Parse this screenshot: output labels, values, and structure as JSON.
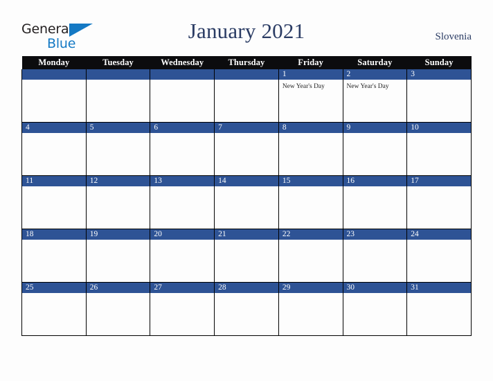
{
  "brand": {
    "word_one": "General",
    "word_two": "Blue",
    "triangle_icon": "triangle-icon",
    "color_dark": "#231f20",
    "color_blue": "#1479c4"
  },
  "header": {
    "title": "January 2021",
    "locale": "Slovenia",
    "title_color": "#2b3c64"
  },
  "calendar": {
    "header_bg": "#0c0c0e",
    "daybar_bg": "#2e5395",
    "cell_bg": "#fdfdfd",
    "weekday_headers": [
      "Monday",
      "Tuesday",
      "Wednesday",
      "Thursday",
      "Friday",
      "Saturday",
      "Sunday"
    ],
    "weeks": [
      [
        {
          "date": "",
          "events": []
        },
        {
          "date": "",
          "events": []
        },
        {
          "date": "",
          "events": []
        },
        {
          "date": "",
          "events": []
        },
        {
          "date": "1",
          "events": [
            "New Year's Day"
          ]
        },
        {
          "date": "2",
          "events": [
            "New Year's Day"
          ]
        },
        {
          "date": "3",
          "events": []
        }
      ],
      [
        {
          "date": "4",
          "events": []
        },
        {
          "date": "5",
          "events": []
        },
        {
          "date": "6",
          "events": []
        },
        {
          "date": "7",
          "events": []
        },
        {
          "date": "8",
          "events": []
        },
        {
          "date": "9",
          "events": []
        },
        {
          "date": "10",
          "events": []
        }
      ],
      [
        {
          "date": "11",
          "events": []
        },
        {
          "date": "12",
          "events": []
        },
        {
          "date": "13",
          "events": []
        },
        {
          "date": "14",
          "events": []
        },
        {
          "date": "15",
          "events": []
        },
        {
          "date": "16",
          "events": []
        },
        {
          "date": "17",
          "events": []
        }
      ],
      [
        {
          "date": "18",
          "events": []
        },
        {
          "date": "19",
          "events": []
        },
        {
          "date": "20",
          "events": []
        },
        {
          "date": "21",
          "events": []
        },
        {
          "date": "22",
          "events": []
        },
        {
          "date": "23",
          "events": []
        },
        {
          "date": "24",
          "events": []
        }
      ],
      [
        {
          "date": "25",
          "events": []
        },
        {
          "date": "26",
          "events": []
        },
        {
          "date": "27",
          "events": []
        },
        {
          "date": "28",
          "events": []
        },
        {
          "date": "29",
          "events": []
        },
        {
          "date": "30",
          "events": []
        },
        {
          "date": "31",
          "events": []
        }
      ]
    ]
  }
}
